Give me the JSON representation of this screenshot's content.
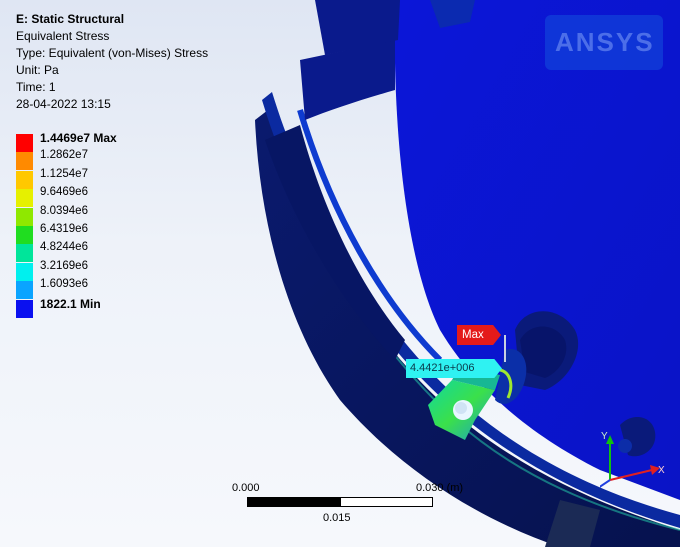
{
  "header": {
    "title": "E: Static Structural",
    "result": "Equivalent Stress",
    "type": "Type: Equivalent (von-Mises) Stress",
    "unit": "Unit: Pa",
    "time": "Time: 1",
    "date": "28-04-2022 13:15"
  },
  "legend": {
    "items": [
      {
        "label": "1.4469e7 Max",
        "color": "#ff0000",
        "bold": true
      },
      {
        "label": "1.2862e7",
        "color": "#ff8a00"
      },
      {
        "label": "1.1254e7",
        "color": "#ffc800"
      },
      {
        "label": "9.6469e6",
        "color": "#e6f000"
      },
      {
        "label": "8.0394e6",
        "color": "#8fe800"
      },
      {
        "label": "6.4319e6",
        "color": "#20dd20"
      },
      {
        "label": "4.8244e6",
        "color": "#00e59a"
      },
      {
        "label": "3.2169e6",
        "color": "#00f0ee"
      },
      {
        "label": "1.6093e6",
        "color": "#0aa4ff"
      },
      {
        "label": "1822.1 Min",
        "color": "#0a10f0",
        "bold": true
      }
    ]
  },
  "probes": {
    "max_label": "Max",
    "value_label": "4.4421e+006"
  },
  "scale": {
    "left": "0.000",
    "right": "0.030 (m)",
    "mid": "0.015"
  },
  "triad": {
    "x": "X",
    "y": "Y"
  },
  "watermark": "ANSYS"
}
